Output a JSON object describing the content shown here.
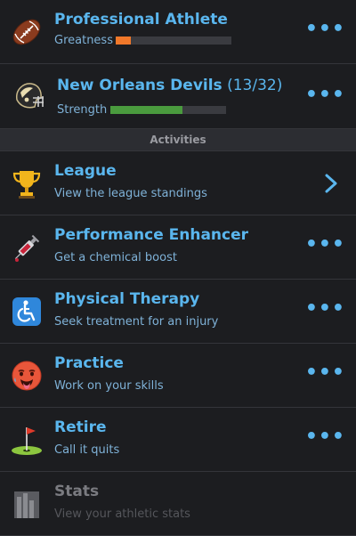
{
  "career": {
    "title": "Professional Athlete",
    "stat_label": "Greatness",
    "stat_level": 0.13,
    "stat_color": "#f0782a"
  },
  "team": {
    "name": "New Orleans Devils",
    "rank": "(13/32)",
    "stat_label": "Strength",
    "stat_level": 0.62,
    "stat_color": "#4a9b3e"
  },
  "section_header": "Activities",
  "activities": [
    {
      "title": "League",
      "subtitle": "View the league standings",
      "icon": "trophy-icon",
      "action": "chevron"
    },
    {
      "title": "Performance Enhancer",
      "subtitle": "Get a chemical boost",
      "icon": "syringe-icon",
      "action": "more"
    },
    {
      "title": "Physical Therapy",
      "subtitle": "Seek treatment for an injury",
      "icon": "wheelchair-icon",
      "action": "more"
    },
    {
      "title": "Practice",
      "subtitle": "Work on your skills",
      "icon": "hot-face-icon",
      "action": "more"
    },
    {
      "title": "Retire",
      "subtitle": "Call it quits",
      "icon": "golf-flag-icon",
      "action": "more"
    },
    {
      "title": "Stats",
      "subtitle": "View your athletic stats",
      "icon": "stats-icon",
      "action": "none"
    }
  ],
  "more_glyph": "•••",
  "colors": {
    "accent": "#5ab6ee",
    "background": "#1c1d20"
  }
}
